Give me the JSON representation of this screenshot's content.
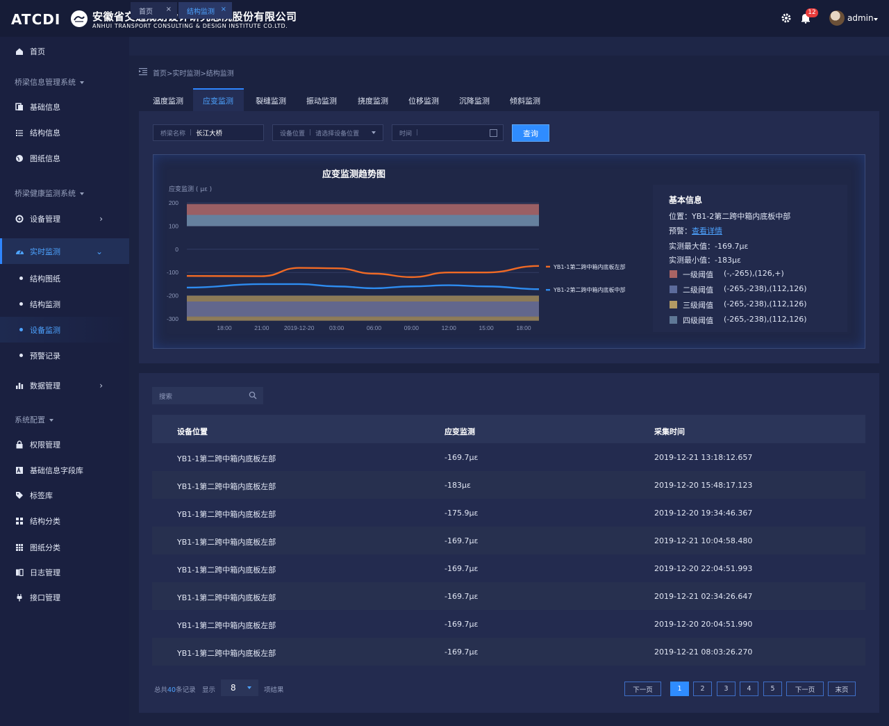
{
  "header": {
    "logo_text": "ATCDI",
    "company_cn": "安徽省交通规划设计研究总院股份有限公司",
    "company_en": "ANHUI TRANSPORT CONSULTING & DESIGN INSTITUTE CO.LTD.",
    "notification_count": "12",
    "username": "admin"
  },
  "sidebar": {
    "home": "首页",
    "group_bridge_info": "桥梁信息管理系统",
    "basic_info": "基础信息",
    "structure_info": "结构信息",
    "drawing_info": "图纸信息",
    "group_health": "桥梁健康监测系统",
    "device_mgmt": "设备管理",
    "realtime": "实时监测",
    "sub_drawing": "结构图纸",
    "sub_structure": "结构监测",
    "sub_device": "设备监测",
    "sub_alarm": "预警记录",
    "data_mgmt": "数据管理",
    "group_system": "系统配置",
    "permission": "权限管理",
    "field_lib": "基础信息字段库",
    "tag_lib": "标签库",
    "struct_class": "结构分类",
    "drawing_class": "图纸分类",
    "log_mgmt": "日志管理",
    "api_mgmt": "接口管理"
  },
  "tabs": [
    {
      "label": "首页",
      "close": "×"
    },
    {
      "label": "结构监测",
      "close": "×"
    }
  ],
  "breadcrumb": "首页>实时监测>结构监测",
  "monitor_tabs": [
    "温度监测",
    "应变监测",
    "裂缝监测",
    "振动监测",
    "挠度监测",
    "位移监测",
    "沉降监测",
    "倾斜监测"
  ],
  "filters": {
    "bridge_label": "桥梁名称",
    "bridge_value": "长江大桥",
    "device_label": "设备位置",
    "device_placeholder": "请选择设备位置",
    "time_label": "时间",
    "query_button": "查询"
  },
  "chart_data": {
    "type": "line",
    "title": "应变监测趋势图",
    "ylabel": "应变监测 ( με )",
    "ylim": [
      -300,
      200
    ],
    "yticks": [
      "200",
      "100",
      "0",
      "-100",
      "-200",
      "-300"
    ],
    "x": [
      "18:00",
      "21:00",
      "2019-12-20",
      "03:00",
      "06:00",
      "09:00",
      "12:00",
      "15:00",
      "18:00"
    ],
    "series": [
      {
        "name": "YB1-1第二跨中箱内底板左部",
        "color": "#f06a25",
        "values": [
          -115,
          -116,
          -80,
          -82,
          -105,
          -120,
          -100,
          -100,
          -72
        ]
      },
      {
        "name": "YB1-2第二跨中箱内底板中部",
        "color": "#2e8cf0",
        "values": [
          -165,
          -150,
          -150,
          -160,
          -168,
          -160,
          -155,
          -160,
          -172
        ]
      }
    ],
    "bands": [
      {
        "from": 100,
        "to": 195,
        "color": "#b06a6a"
      },
      {
        "from": 100,
        "to": 148,
        "color": "#5c86a8"
      },
      {
        "from": -308,
        "to": -200,
        "color": "#a08a5a"
      },
      {
        "from": -290,
        "to": -225,
        "color": "#5a6496"
      }
    ]
  },
  "info": {
    "title": "基本信息",
    "location_label": "位置：",
    "location": "YB1-2第二跨中箱内底板中部",
    "warning_label": "预警：",
    "warning_link": "查看详情",
    "max_label": "实测最大值：",
    "max": "-169.7με",
    "min_label": "实测最小值：",
    "min": "-183με",
    "thresholds": [
      {
        "label": "一级阈值",
        "range": "(-,-265),(126,+)",
        "color": "#a96464"
      },
      {
        "label": "二级阈值",
        "range": "(-265,-238),(112,126)",
        "color": "#5c6b9c"
      },
      {
        "label": "三级阈值",
        "range": "(-265,-238),(112,126)",
        "color": "#b39a64"
      },
      {
        "label": "四级阈值",
        "range": "(-265,-238),(112,126)",
        "color": "#5f7896"
      }
    ]
  },
  "table": {
    "search_placeholder": "搜索",
    "headers": [
      "设备位置",
      "应变监测",
      "采集时间"
    ],
    "rows": [
      [
        "YB1-1第二跨中箱内底板左部",
        "-169.7με",
        "2019-12-21 13:18:12.657"
      ],
      [
        "YB1-1第二跨中箱内底板左部",
        "-183με",
        "2019-12-20 15:48:17.123"
      ],
      [
        "YB1-1第二跨中箱内底板左部",
        "-175.9με",
        "2019-12-20 19:34:46.367"
      ],
      [
        "YB1-1第二跨中箱内底板左部",
        "-169.7με",
        "2019-12-21 10:04:58.480"
      ],
      [
        "YB1-1第二跨中箱内底板左部",
        "-169.7με",
        "2019-12-20 22:04:51.993"
      ],
      [
        "YB1-1第二跨中箱内底板左部",
        "-169.7με",
        "2019-12-21 02:34:26.647"
      ],
      [
        "YB1-1第二跨中箱内底板左部",
        "-169.7με",
        "2019-12-20 20:04:51.990"
      ],
      [
        "YB1-1第二跨中箱内底板左部",
        "-169.7με",
        "2019-12-21 08:03:26.270"
      ]
    ]
  },
  "pagination": {
    "total_prefix": "总共",
    "total": "40",
    "total_suffix": "条记录",
    "show_label": "显示",
    "page_size": "8",
    "result_label": "项结果",
    "prev": "下一页",
    "pages": [
      "1",
      "2",
      "3",
      "4",
      "5"
    ],
    "next": "下一页",
    "last": "末页"
  }
}
